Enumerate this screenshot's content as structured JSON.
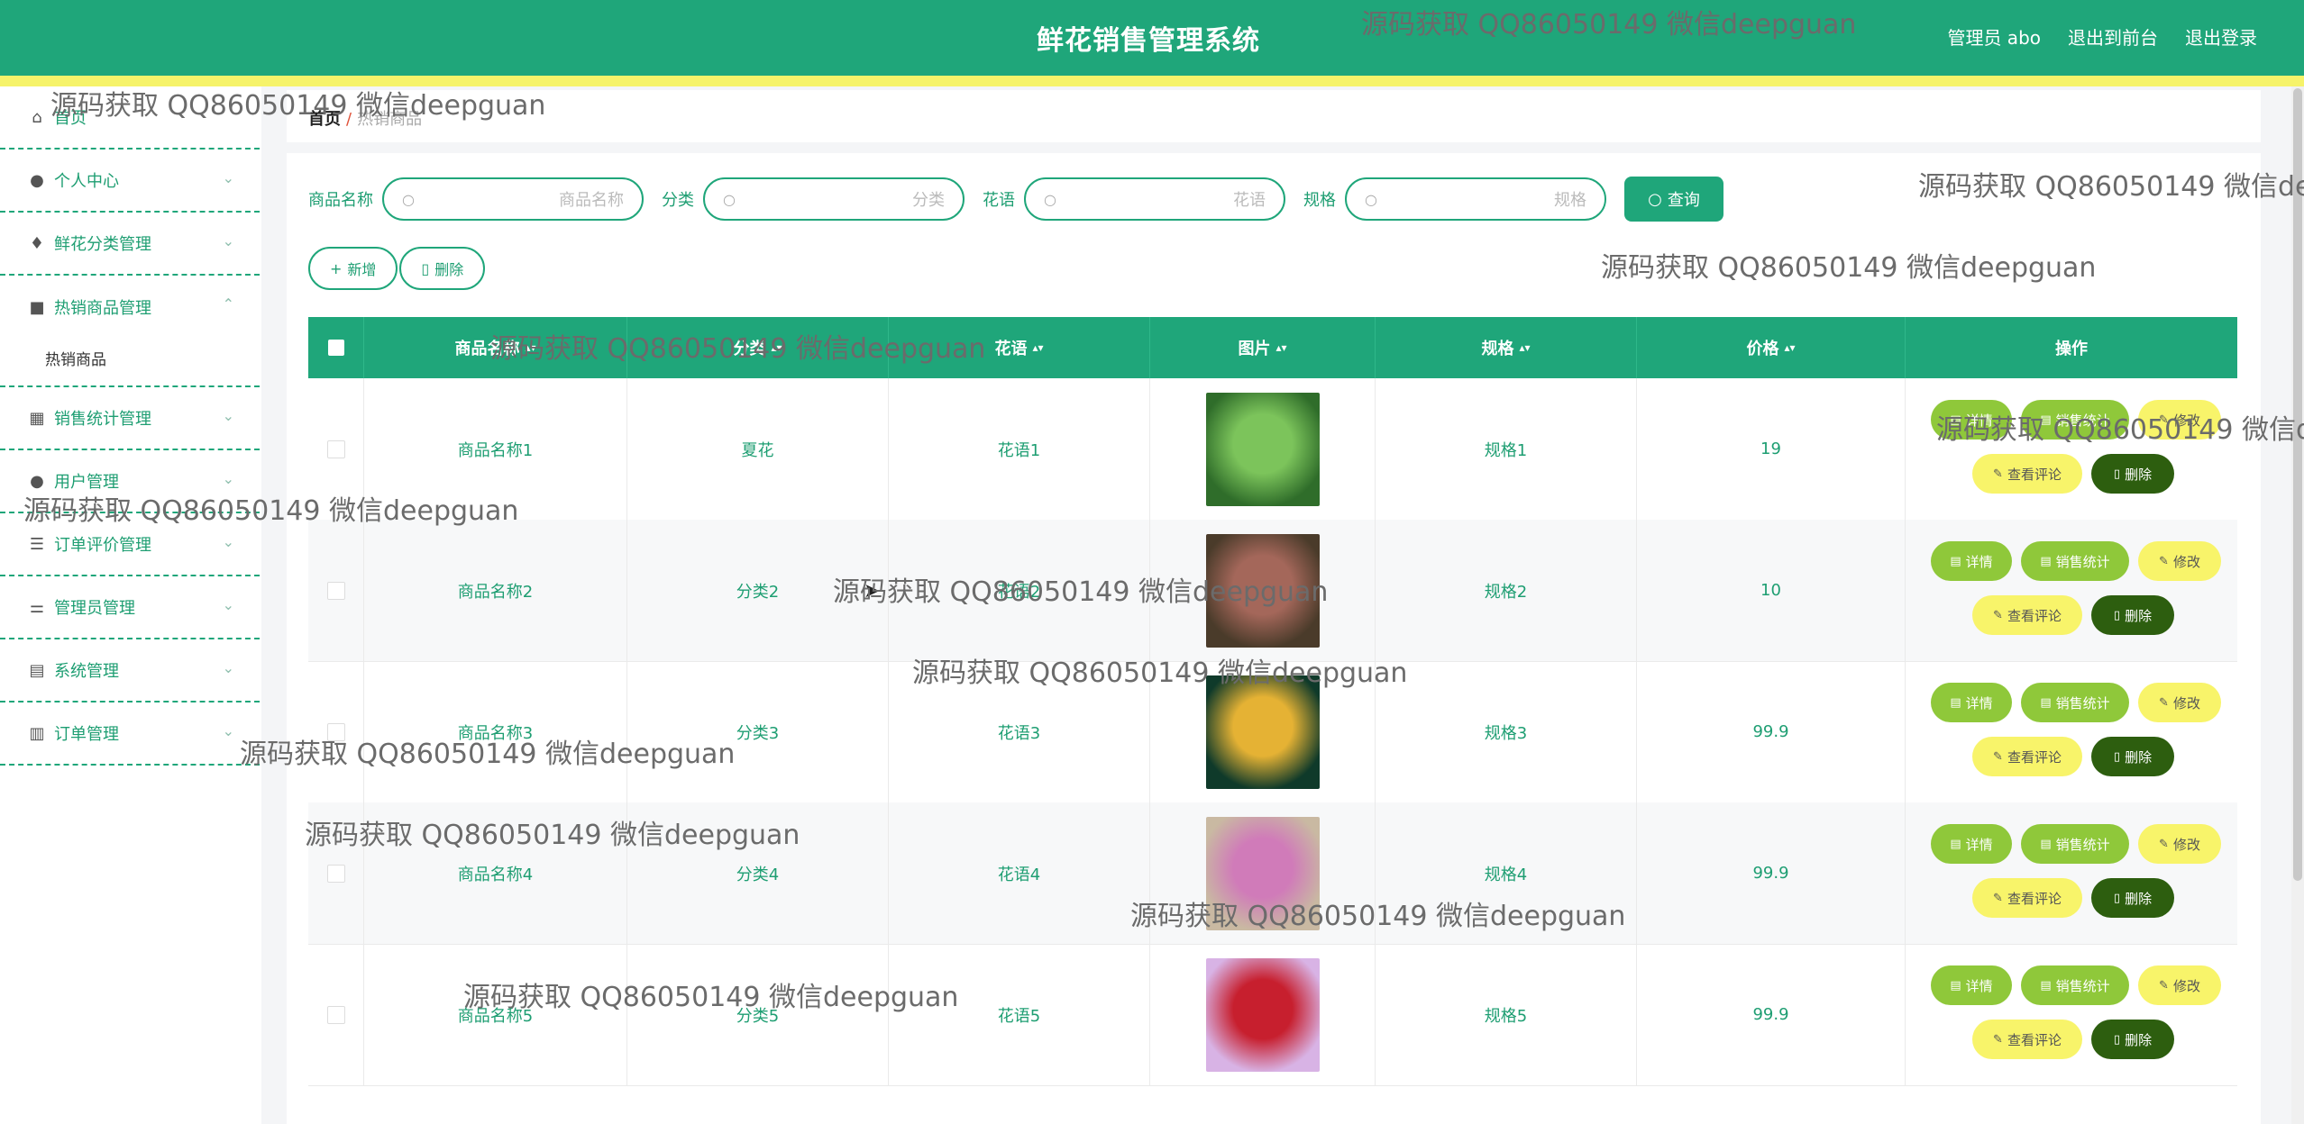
{
  "header": {
    "title": "鲜花销售管理系统",
    "links": [
      "管理员 abo",
      "退出到前台",
      "退出登录"
    ]
  },
  "sidebar": {
    "items": [
      {
        "label": "首页",
        "icon": "home-icon"
      },
      {
        "label": "个人中心",
        "icon": "user-icon"
      },
      {
        "label": "鲜花分类管理",
        "icon": "mic-icon"
      },
      {
        "label": "热销商品管理",
        "icon": "book-icon"
      },
      {
        "label": "销售统计管理",
        "icon": "grid-icon"
      },
      {
        "label": "用户管理",
        "icon": "user-icon"
      },
      {
        "label": "订单评价管理",
        "icon": "list-icon"
      },
      {
        "label": "管理员管理",
        "icon": "sliders-icon"
      },
      {
        "label": "系统管理",
        "icon": "doc-icon"
      },
      {
        "label": "订单管理",
        "icon": "chart-icon"
      }
    ],
    "sub_item": "热销商品"
  },
  "breadcrumb": {
    "home": "首页",
    "sep": "/",
    "current": "热销商品"
  },
  "search": {
    "fields": [
      {
        "label": "商品名称",
        "placeholder": "商品名称"
      },
      {
        "label": "分类",
        "placeholder": "分类"
      },
      {
        "label": "花语",
        "placeholder": "花语"
      },
      {
        "label": "规格",
        "placeholder": "规格"
      }
    ],
    "query_label": "查询"
  },
  "actions": {
    "add_label": "新增",
    "delete_label": "删除"
  },
  "table": {
    "headers": [
      "商品名称",
      "分类",
      "花语",
      "图片",
      "规格",
      "价格",
      "操作"
    ],
    "rows": [
      {
        "name": "商品名称1",
        "category": "夏花",
        "language": "花语1",
        "spec": "规格1",
        "price": "19"
      },
      {
        "name": "商品名称2",
        "category": "分类2",
        "language": "花语2",
        "spec": "规格2",
        "price": "10"
      },
      {
        "name": "商品名称3",
        "category": "分类3",
        "language": "花语3",
        "spec": "规格3",
        "price": "99.9"
      },
      {
        "name": "商品名称4",
        "category": "分类4",
        "language": "花语4",
        "spec": "规格4",
        "price": "99.9"
      },
      {
        "name": "商品名称5",
        "category": "分类5",
        "language": "花语5",
        "spec": "规格5",
        "price": "99.9"
      }
    ],
    "ops": {
      "detail": "详情",
      "stat": "销售统计",
      "edit": "修改",
      "review": "查看评论",
      "delete": "删除"
    }
  },
  "watermark": "源码获取 QQ86050149 微信deepguan",
  "colors": {
    "primary": "#1fa67a",
    "stripe": "#f6f36a",
    "detail": "#8fc83a",
    "edit": "#f8f46a",
    "delete": "#2d5e0f"
  }
}
